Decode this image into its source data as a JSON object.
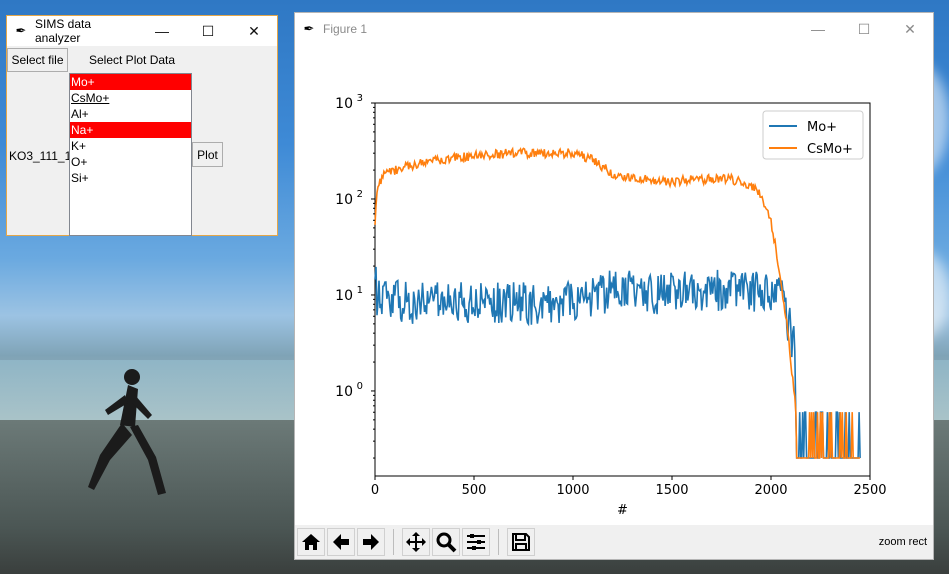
{
  "tk_window": {
    "title": "SIMS data analyzer",
    "select_file_label": "Select file",
    "select_plot_data_label": "Select Plot Data",
    "file_name": "KO3_111_1",
    "plot_label": "Plot",
    "list_items": [
      {
        "label": "Mo+",
        "selected": true
      },
      {
        "label": "CsMo+",
        "selected": false
      },
      {
        "label": "Al+",
        "selected": false
      },
      {
        "label": "Na+",
        "selected": true
      },
      {
        "label": "K+",
        "selected": false
      },
      {
        "label": "O+",
        "selected": false
      },
      {
        "label": "Si+",
        "selected": false
      }
    ]
  },
  "figure_window": {
    "title": "Figure 1",
    "status_message": "zoom rect",
    "toolbar_icons": [
      "home-icon",
      "back-arrow-icon",
      "forward-arrow-icon",
      "pan-icon",
      "zoom-icon",
      "configure-subplots-icon",
      "save-icon"
    ]
  },
  "colors": {
    "series_mo": "#1f77b4",
    "series_csmo": "#ff7f0e",
    "selection": "#ff0000",
    "tk_border": "#e3a74a"
  },
  "chart_data": {
    "type": "line",
    "xlabel": "#",
    "ylabel": "",
    "xlim": [
      0,
      2500
    ],
    "ylim": [
      0.13,
      1000
    ],
    "yscale": "log",
    "x_ticks": [
      "0",
      "500",
      "1000",
      "1500",
      "2000",
      "2500"
    ],
    "y_ticks": [
      "10",
      "10",
      "10",
      "10"
    ],
    "y_tick_exponents": [
      "0",
      "1",
      "2",
      "3"
    ],
    "legend_placement": "top-right",
    "series": [
      {
        "name": "Mo+",
        "x": [
          0,
          10,
          50,
          100,
          200,
          300,
          400,
          500,
          600,
          700,
          800,
          900,
          1000,
          1100,
          1200,
          1300,
          1400,
          1500,
          1600,
          1700,
          1800,
          1900,
          1950,
          2000,
          2050,
          2080,
          2100,
          2120,
          2150,
          2200,
          2300,
          2400,
          2450
        ],
        "values": [
          20,
          10,
          9,
          9,
          8,
          9,
          8.5,
          8,
          8,
          8.5,
          8,
          8,
          9,
          10,
          11,
          11,
          10,
          10.5,
          11,
          11,
          11,
          11,
          11,
          11,
          10,
          6,
          4,
          3,
          1,
          0.3,
          0.25,
          0.25,
          0.25
        ]
      },
      {
        "name": "CsMo+",
        "x": [
          0,
          10,
          30,
          50,
          100,
          200,
          300,
          400,
          500,
          600,
          700,
          800,
          900,
          1000,
          1050,
          1100,
          1200,
          1300,
          1400,
          1500,
          1600,
          1700,
          1800,
          1900,
          1950,
          2000,
          2030,
          2060,
          2080,
          2100,
          2120,
          2150,
          2200,
          2300,
          2400,
          2450
        ],
        "values": [
          60,
          120,
          160,
          180,
          200,
          230,
          250,
          270,
          280,
          290,
          300,
          300,
          300,
          300,
          280,
          260,
          180,
          170,
          160,
          150,
          160,
          160,
          160,
          140,
          110,
          60,
          25,
          10,
          5,
          2,
          0.8,
          0.3,
          0.2,
          0.2,
          0.2,
          0.2
        ]
      }
    ]
  }
}
